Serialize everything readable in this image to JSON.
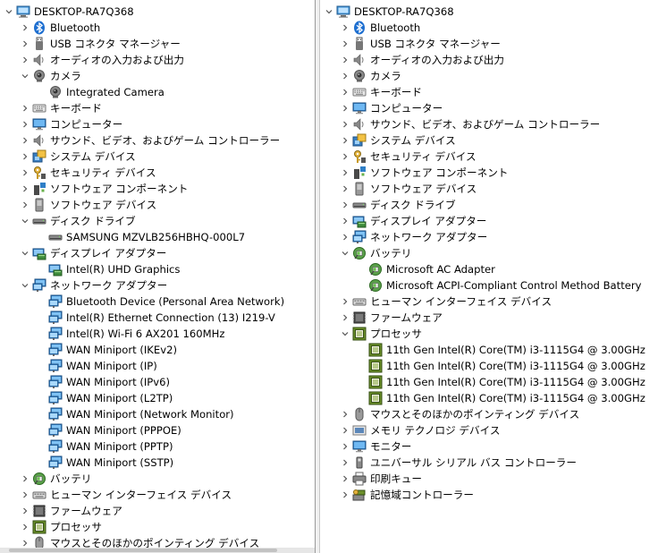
{
  "left": {
    "computer": "DESKTOP-RA7Q368",
    "items": [
      {
        "label": "Bluetooth",
        "icon": "bluetooth-icon",
        "chev": "right",
        "depth": 1
      },
      {
        "label": "USB コネクタ マネージャー",
        "icon": "usb-icon",
        "chev": "right",
        "depth": 1
      },
      {
        "label": "オーディオの入力および出力",
        "icon": "speaker-icon",
        "chev": "right",
        "depth": 1
      },
      {
        "label": "カメラ",
        "icon": "camera-icon",
        "chev": "down",
        "depth": 1
      },
      {
        "label": "Integrated Camera",
        "icon": "camera-icon",
        "chev": "none",
        "depth": 2
      },
      {
        "label": "キーボード",
        "icon": "keyboard-icon",
        "chev": "right",
        "depth": 1
      },
      {
        "label": "コンピューター",
        "icon": "monitor-icon",
        "chev": "right",
        "depth": 1
      },
      {
        "label": "サウンド、ビデオ、およびゲーム コントローラー",
        "icon": "speaker-icon",
        "chev": "right",
        "depth": 1
      },
      {
        "label": "システム デバイス",
        "icon": "system-device-icon",
        "chev": "right",
        "depth": 1
      },
      {
        "label": "セキュリティ デバイス",
        "icon": "security-key-icon",
        "chev": "right",
        "depth": 1
      },
      {
        "label": "ソフトウェア コンポーネント",
        "icon": "software-component-icon",
        "chev": "right",
        "depth": 1
      },
      {
        "label": "ソフトウェア デバイス",
        "icon": "software-device-icon",
        "chev": "right",
        "depth": 1
      },
      {
        "label": "ディスク ドライブ",
        "icon": "disk-drive-icon",
        "chev": "down",
        "depth": 1
      },
      {
        "label": "SAMSUNG MZVLB256HBHQ-000L7",
        "icon": "disk-drive-icon",
        "chev": "none",
        "depth": 2
      },
      {
        "label": "ディスプレイ アダプター",
        "icon": "display-adapter-icon",
        "chev": "down",
        "depth": 1
      },
      {
        "label": "Intel(R) UHD Graphics",
        "icon": "display-adapter-icon",
        "chev": "none",
        "depth": 2
      },
      {
        "label": "ネットワーク アダプター",
        "icon": "network-adapter-icon",
        "chev": "down",
        "depth": 1
      },
      {
        "label": "Bluetooth Device (Personal Area Network)",
        "icon": "network-adapter-icon",
        "chev": "none",
        "depth": 2
      },
      {
        "label": "Intel(R) Ethernet Connection (13) I219-V",
        "icon": "network-adapter-icon",
        "chev": "none",
        "depth": 2
      },
      {
        "label": "Intel(R) Wi-Fi 6 AX201 160MHz",
        "icon": "network-adapter-icon",
        "chev": "none",
        "depth": 2
      },
      {
        "label": "WAN Miniport (IKEv2)",
        "icon": "network-adapter-icon",
        "chev": "none",
        "depth": 2
      },
      {
        "label": "WAN Miniport (IP)",
        "icon": "network-adapter-icon",
        "chev": "none",
        "depth": 2
      },
      {
        "label": "WAN Miniport (IPv6)",
        "icon": "network-adapter-icon",
        "chev": "none",
        "depth": 2
      },
      {
        "label": "WAN Miniport (L2TP)",
        "icon": "network-adapter-icon",
        "chev": "none",
        "depth": 2
      },
      {
        "label": "WAN Miniport (Network Monitor)",
        "icon": "network-adapter-icon",
        "chev": "none",
        "depth": 2
      },
      {
        "label": "WAN Miniport (PPPOE)",
        "icon": "network-adapter-icon",
        "chev": "none",
        "depth": 2
      },
      {
        "label": "WAN Miniport (PPTP)",
        "icon": "network-adapter-icon",
        "chev": "none",
        "depth": 2
      },
      {
        "label": "WAN Miniport (SSTP)",
        "icon": "network-adapter-icon",
        "chev": "none",
        "depth": 2
      },
      {
        "label": "バッテリ",
        "icon": "battery-icon",
        "chev": "right",
        "depth": 1
      },
      {
        "label": "ヒューマン インターフェイス デバイス",
        "icon": "hid-icon",
        "chev": "right",
        "depth": 1
      },
      {
        "label": "ファームウェア",
        "icon": "firmware-icon",
        "chev": "right",
        "depth": 1
      },
      {
        "label": "プロセッサ",
        "icon": "processor-icon",
        "chev": "right",
        "depth": 1
      },
      {
        "label": "マウスとそのほかのポインティング デバイス",
        "icon": "mouse-icon",
        "chev": "right",
        "depth": 1
      }
    ]
  },
  "right": {
    "computer": "DESKTOP-RA7Q368",
    "items": [
      {
        "label": "Bluetooth",
        "icon": "bluetooth-icon",
        "chev": "right",
        "depth": 1
      },
      {
        "label": "USB コネクタ マネージャー",
        "icon": "usb-icon",
        "chev": "right",
        "depth": 1
      },
      {
        "label": "オーディオの入力および出力",
        "icon": "speaker-icon",
        "chev": "right",
        "depth": 1
      },
      {
        "label": "カメラ",
        "icon": "camera-icon",
        "chev": "right",
        "depth": 1
      },
      {
        "label": "キーボード",
        "icon": "keyboard-icon",
        "chev": "right",
        "depth": 1
      },
      {
        "label": "コンピューター",
        "icon": "monitor-icon",
        "chev": "right",
        "depth": 1
      },
      {
        "label": "サウンド、ビデオ、およびゲーム コントローラー",
        "icon": "speaker-icon",
        "chev": "right",
        "depth": 1
      },
      {
        "label": "システム デバイス",
        "icon": "system-device-icon",
        "chev": "right",
        "depth": 1
      },
      {
        "label": "セキュリティ デバイス",
        "icon": "security-key-icon",
        "chev": "right",
        "depth": 1
      },
      {
        "label": "ソフトウェア コンポーネント",
        "icon": "software-component-icon",
        "chev": "right",
        "depth": 1
      },
      {
        "label": "ソフトウェア デバイス",
        "icon": "software-device-icon",
        "chev": "right",
        "depth": 1
      },
      {
        "label": "ディスク ドライブ",
        "icon": "disk-drive-icon",
        "chev": "right",
        "depth": 1
      },
      {
        "label": "ディスプレイ アダプター",
        "icon": "display-adapter-icon",
        "chev": "right",
        "depth": 1
      },
      {
        "label": "ネットワーク アダプター",
        "icon": "network-adapter-icon",
        "chev": "right",
        "depth": 1
      },
      {
        "label": "バッテリ",
        "icon": "battery-icon",
        "chev": "down",
        "depth": 1
      },
      {
        "label": "Microsoft AC Adapter",
        "icon": "battery-icon",
        "chev": "none",
        "depth": 2
      },
      {
        "label": "Microsoft ACPI-Compliant Control Method Battery",
        "icon": "battery-icon",
        "chev": "none",
        "depth": 2
      },
      {
        "label": "ヒューマン インターフェイス デバイス",
        "icon": "hid-icon",
        "chev": "right",
        "depth": 1
      },
      {
        "label": "ファームウェア",
        "icon": "firmware-icon",
        "chev": "right",
        "depth": 1
      },
      {
        "label": "プロセッサ",
        "icon": "processor-icon",
        "chev": "down",
        "depth": 1
      },
      {
        "label": "11th Gen Intel(R) Core(TM) i3-1115G4 @ 3.00GHz",
        "icon": "processor-icon",
        "chev": "none",
        "depth": 2
      },
      {
        "label": "11th Gen Intel(R) Core(TM) i3-1115G4 @ 3.00GHz",
        "icon": "processor-icon",
        "chev": "none",
        "depth": 2
      },
      {
        "label": "11th Gen Intel(R) Core(TM) i3-1115G4 @ 3.00GHz",
        "icon": "processor-icon",
        "chev": "none",
        "depth": 2
      },
      {
        "label": "11th Gen Intel(R) Core(TM) i3-1115G4 @ 3.00GHz",
        "icon": "processor-icon",
        "chev": "none",
        "depth": 2
      },
      {
        "label": "マウスとそのほかのポインティング デバイス",
        "icon": "mouse-icon",
        "chev": "right",
        "depth": 1
      },
      {
        "label": "メモリ テクノロジ デバイス",
        "icon": "memory-tech-icon",
        "chev": "right",
        "depth": 1
      },
      {
        "label": "モニター",
        "icon": "monitor-icon",
        "chev": "right",
        "depth": 1
      },
      {
        "label": "ユニバーサル シリアル バス コントローラー",
        "icon": "usb-controller-icon",
        "chev": "right",
        "depth": 1
      },
      {
        "label": "印刷キュー",
        "icon": "printer-icon",
        "chev": "right",
        "depth": 1
      },
      {
        "label": "記憶域コントローラー",
        "icon": "storage-controller-icon",
        "chev": "right",
        "depth": 1
      }
    ]
  }
}
